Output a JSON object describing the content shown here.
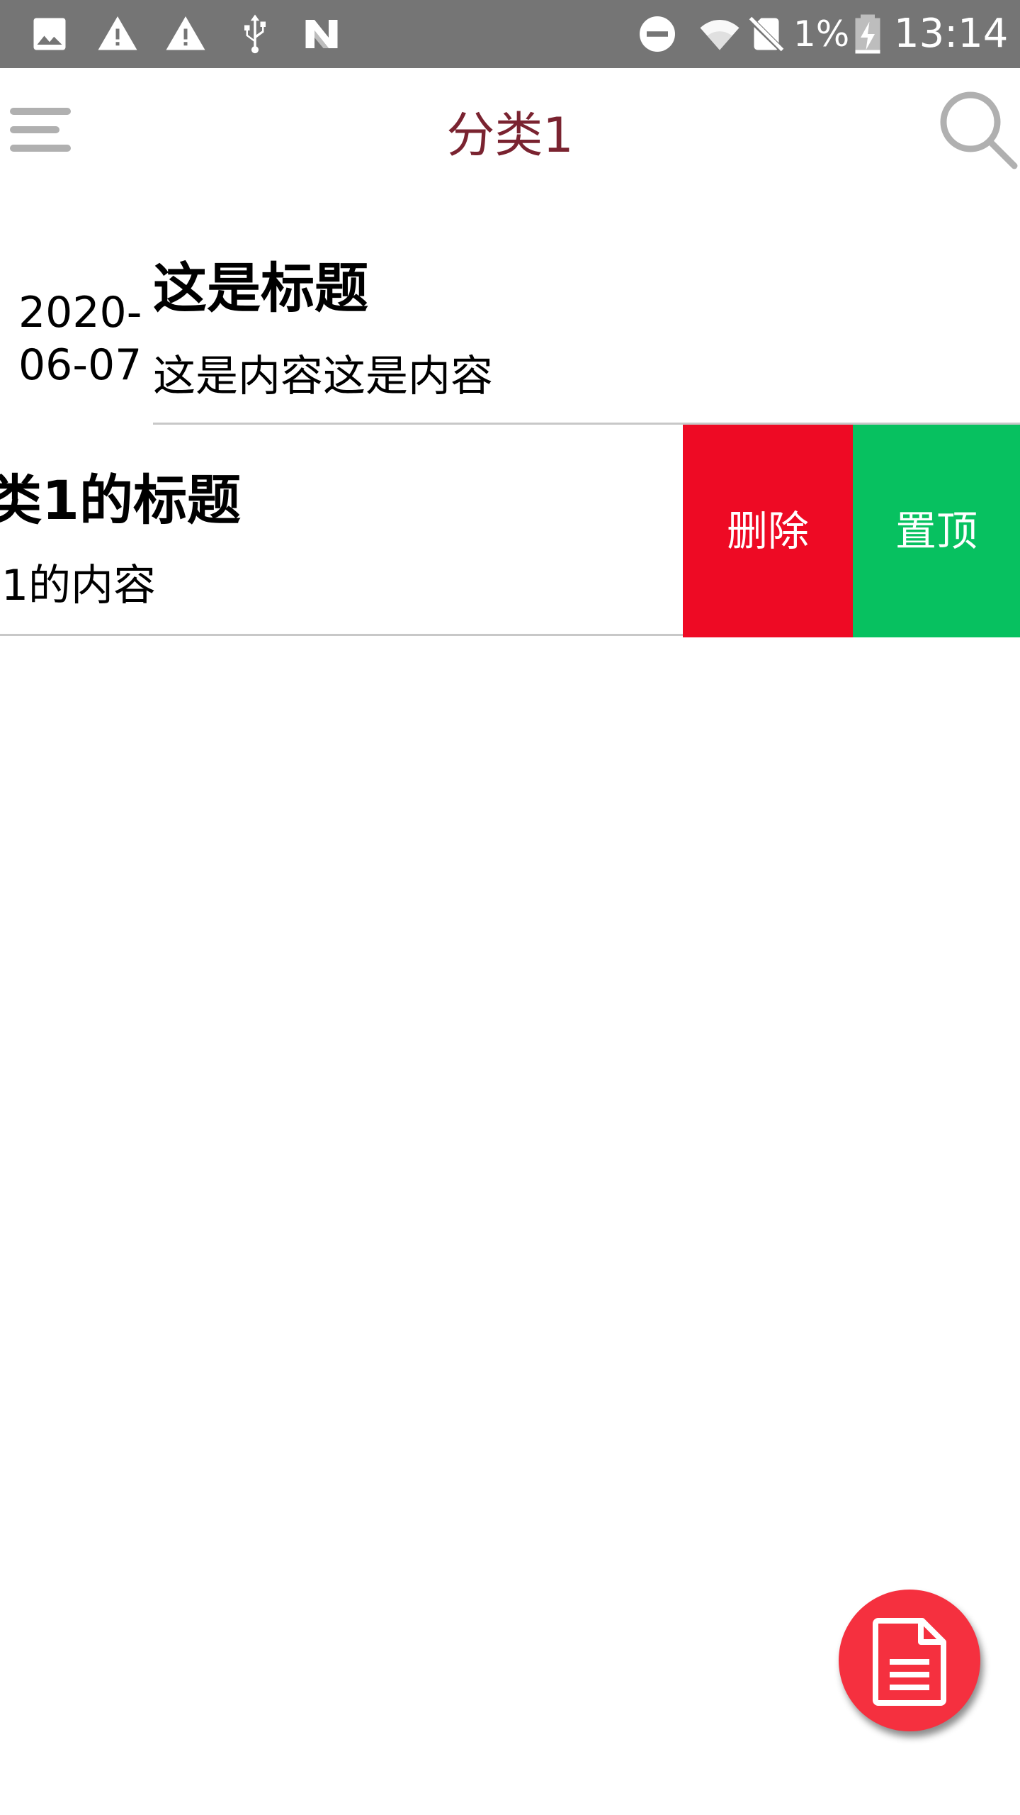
{
  "status_bar": {
    "battery_percent": "1%",
    "time": "13:14",
    "icons": [
      "image-icon",
      "warning-icon",
      "warning-icon",
      "usb-icon",
      "n-icon",
      "dnd-icon",
      "wifi-icon",
      "no-sim-icon",
      "battery-charging-icon"
    ]
  },
  "app_bar": {
    "title": "分类1",
    "menu_icon": "menu-icon",
    "search_icon": "search-icon"
  },
  "notes": [
    {
      "date": "2020-\n06-07",
      "title": "这是标题",
      "content": "这是内容这是内容"
    },
    {
      "title": "类1的标题",
      "content": "1的内容",
      "swiped": true,
      "actions": {
        "delete_label": "删除",
        "pin_label": "置顶"
      }
    }
  ],
  "fab": {
    "icon": "document-icon"
  },
  "colors": {
    "status_bar": "#757575",
    "title": "#7a2330",
    "delete": "#ee0a24",
    "pin": "#07c160",
    "fab": "#f5303f",
    "divider": "#c8c8c8"
  }
}
